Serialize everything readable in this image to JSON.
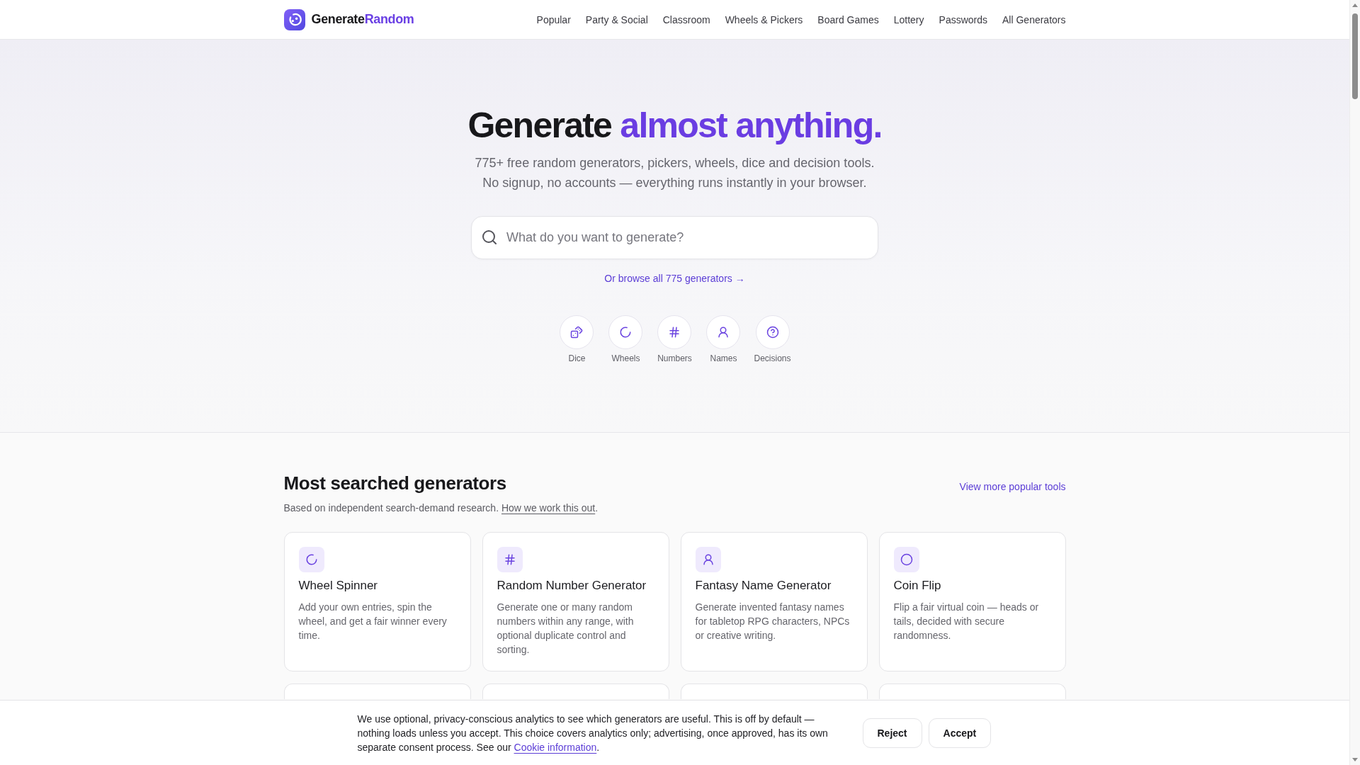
{
  "header": {
    "brand": {
      "name": "Generate",
      "accent": "Random"
    },
    "nav": [
      "Popular",
      "Party & Social",
      "Classroom",
      "Wheels & Pickers",
      "Board Games",
      "Lottery",
      "Passwords",
      "All Generators"
    ]
  },
  "hero": {
    "title": {
      "text": "Generate",
      "accent": "almost anything."
    },
    "subtitle": [
      "775+ free random generators, pickers, wheels, dice and decision tools.",
      "No signup, no accounts — everything runs instantly in your browser."
    ],
    "search": {
      "placeholder": "What do you want to generate?"
    },
    "browse_link": "Or browse all 775 generators →",
    "categories": [
      {
        "label": "Dice"
      },
      {
        "label": "Wheels"
      },
      {
        "label": "Numbers"
      },
      {
        "label": "Names"
      },
      {
        "label": "Decisions"
      }
    ]
  },
  "popular": {
    "title": "Most searched generators",
    "more_link": "View more popular tools",
    "subtitle": {
      "text": "Based on independent search-demand research.",
      "link": "How we work this out",
      "after": "."
    },
    "cards": [
      {
        "title": "Wheel Spinner",
        "description": "Add your own entries, spin the wheel, and get a fair winner every time."
      },
      {
        "title": "Random Number Generator",
        "description": "Generate one or many random numbers within any range, with optional duplicate control and sorting."
      },
      {
        "title": "Fantasy Name Generator",
        "description": "Generate invented fantasy names for tabletop RPG characters, NPCs or creative writing."
      },
      {
        "title": "Coin Flip",
        "description": "Flip a fair virtual coin — heads or tails, decided with secure randomness."
      }
    ]
  },
  "cookie_banner": {
    "text": "We use optional, privacy-conscious analytics to see which generators are useful. This is off by default — nothing loads unless you accept. This choice covers analytics only; advertising, once approved, has its own separate consent process. See our",
    "link": "Cookie information",
    "after": ".",
    "buttons": [
      "Reject",
      "Accept"
    ]
  }
}
